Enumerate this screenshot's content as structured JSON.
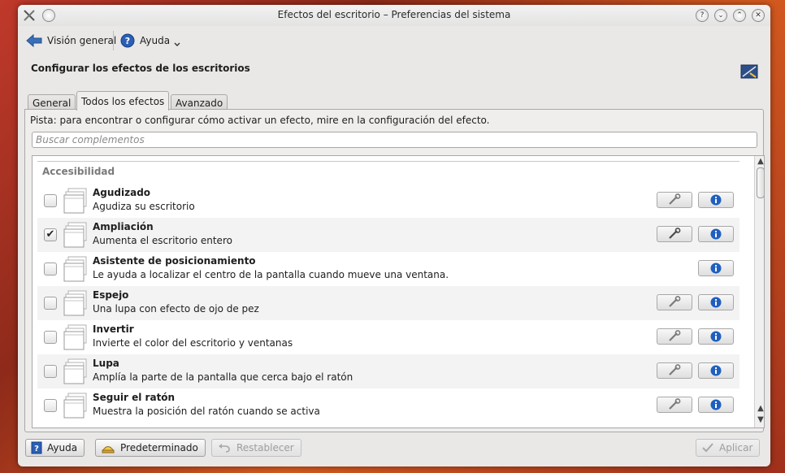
{
  "window": {
    "title": "Efectos del escritorio – Preferencias del sistema",
    "buttons": {
      "help": "?",
      "minimize": "⌄",
      "maximize": "⌃",
      "close": "✕"
    }
  },
  "toolbar": {
    "overview_label": "Visión general",
    "help_label": "Ayuda"
  },
  "header": {
    "title": "Configurar los efectos de los escritorios"
  },
  "tabs": [
    {
      "label": "General"
    },
    {
      "label": "Todos los efectos"
    },
    {
      "label": "Avanzado"
    }
  ],
  "panel": {
    "hint": "Pista: para encontrar o configurar cómo activar un efecto, mire en la configuración del efecto.",
    "search_placeholder": "Buscar complementos",
    "category": "Accesibilidad",
    "effects": [
      {
        "name": "Agudizado",
        "description": "Agudiza su escritorio",
        "checked": false,
        "has_config": true,
        "checkmark": ""
      },
      {
        "name": "Ampliación",
        "description": "Aumenta el escritorio entero",
        "checked": true,
        "has_config": true,
        "checkmark": "✔"
      },
      {
        "name": "Asistente de posicionamiento",
        "description": "Le ayuda a localizar el centro de la pantalla cuando mueve una ventana.",
        "checked": false,
        "has_config": false,
        "checkmark": ""
      },
      {
        "name": "Espejo",
        "description": "Una lupa con efecto de ojo de pez",
        "checked": false,
        "has_config": true,
        "checkmark": ""
      },
      {
        "name": "Invertir",
        "description": "Invierte el color del escritorio y ventanas",
        "checked": false,
        "has_config": true,
        "checkmark": ""
      },
      {
        "name": "Lupa",
        "description": "Amplía la parte de la pantalla que cerca bajo el ratón",
        "checked": false,
        "has_config": true,
        "checkmark": ""
      },
      {
        "name": "Seguir el ratón",
        "description": "Muestra la posición del ratón cuando se activa",
        "checked": false,
        "has_config": true,
        "checkmark": ""
      }
    ]
  },
  "bottom": {
    "help_label": "Ayuda",
    "default_label": "Predeterminado",
    "reset_label": "Restablecer",
    "apply_label": "Aplicar"
  },
  "colors": {
    "info_blue": "#1f5fbf",
    "wrench_gray": "#7a7a7a",
    "window_bg": "#e9e8e7"
  }
}
